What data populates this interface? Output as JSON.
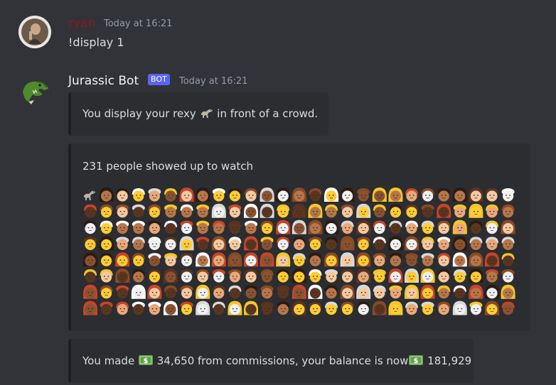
{
  "messages": [
    {
      "author": "ryan",
      "author_color": "#8b1a1a",
      "timestamp": "Today at 16:21",
      "content": "!display 1"
    },
    {
      "author": "Jurassic Bot",
      "author_color": "#f2f3f5",
      "bot_tag": "BOT",
      "timestamp": "Today at 16:21",
      "embeds": [
        {
          "text_before": "You display your rexy",
          "icon": "dinosaur-icon",
          "text_after": "in front of a crowd."
        },
        {
          "title": "231 people showed up to watch",
          "crowd_icon": "dinosaur-icon",
          "crowd_count": 231
        },
        {
          "text_a": "You made",
          "icon": "money-icon",
          "amount": "34,650",
          "text_b": "from commissions, your balance is now",
          "balance": "181,929"
        }
      ]
    }
  ],
  "colors": {
    "background": "#313338",
    "embed_background": "#2b2d31",
    "bot_tag": "#5865f2",
    "money_green": "#5fa04a"
  }
}
